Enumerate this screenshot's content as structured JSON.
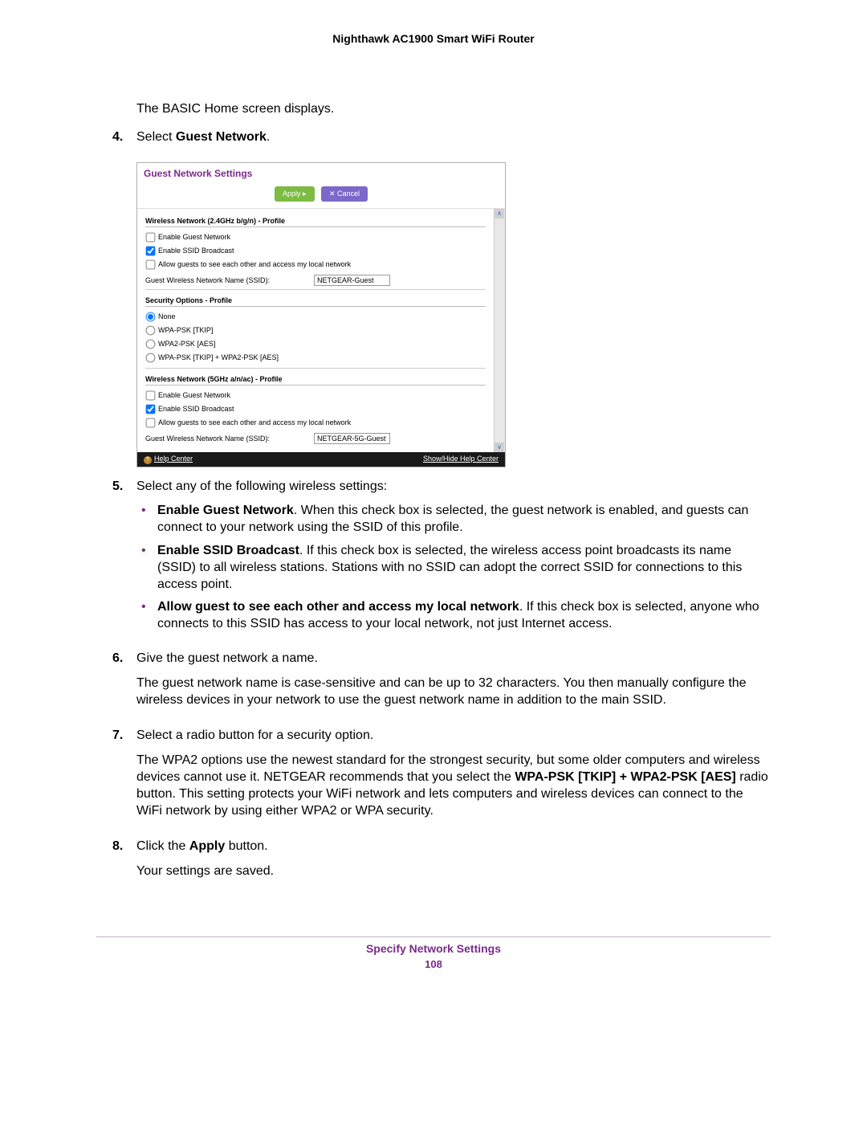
{
  "header": {
    "title": "Nighthawk AC1900 Smart WiFi Router"
  },
  "intro": {
    "line": "The BASIC Home screen displays."
  },
  "step4": {
    "num": "4.",
    "pre": "Select ",
    "bold": "Guest Network",
    "post": "."
  },
  "screenshot": {
    "title": "Guest Network Settings",
    "apply": "Apply ▸",
    "cancel": "✕ Cancel",
    "sec24": {
      "header": "Wireless Network (2.4GHz b/g/n) - Profile",
      "enable_guest": "Enable Guest Network",
      "enable_ssid": "Enable SSID Broadcast",
      "allow_guests": "Allow guests to see each other and access my local network",
      "ssid_label": "Guest Wireless Network Name (SSID):",
      "ssid_value": "NETGEAR-Guest"
    },
    "security": {
      "header": "Security Options - Profile",
      "none": "None",
      "wpa_tkip": "WPA-PSK [TKIP]",
      "wpa2_aes": "WPA2-PSK [AES]",
      "wpa_mix": "WPA-PSK [TKIP] + WPA2-PSK [AES]"
    },
    "sec5": {
      "header": "Wireless Network (5GHz a/n/ac) - Profile",
      "enable_guest": "Enable Guest Network",
      "enable_ssid": "Enable SSID Broadcast",
      "allow_guests": "Allow guests to see each other and access my local network",
      "ssid_label": "Guest Wireless Network Name (SSID):",
      "ssid_value": "NETGEAR-5G-Guest"
    },
    "help_center": "Help Center",
    "show_hide": "Show/Hide Help Center"
  },
  "step5": {
    "num": "5.",
    "text": "Select any of the following wireless settings:",
    "b1_bold": "Enable Guest Network",
    "b1_rest": ". When this check box is selected, the guest network is enabled, and guests can connect to your network using the SSID of this profile.",
    "b2_bold": "Enable SSID Broadcast",
    "b2_rest": ". If this check box is selected, the wireless access point broadcasts its name (SSID) to all wireless stations. Stations with no SSID can adopt the correct SSID for connections to this access point.",
    "b3_bold": "Allow guest to see each other and access my local network",
    "b3_rest": ". If this check box is selected, anyone who connects to this SSID has access to your local network, not just Internet access."
  },
  "step6": {
    "num": "6.",
    "text1": "Give the guest network a name.",
    "text2": "The guest network name is case-sensitive and can be up to 32 characters. You then manually configure the wireless devices in your network to use the guest network name in addition to the main SSID."
  },
  "step7": {
    "num": "7.",
    "text1": "Select a radio button for a security option.",
    "p2_a": "The WPA2 options use the newest standard for the strongest security, but some older computers and wireless devices cannot use it. NETGEAR recommends that you select the ",
    "p2_bold": "WPA-PSK [TKIP] + WPA2-PSK [AES]",
    "p2_b": " radio button. This setting protects your WiFi network and lets computers and wireless devices can connect to the WiFi network by using either WPA2 or WPA security."
  },
  "step8": {
    "num": "8.",
    "pre": "Click the ",
    "bold": "Apply",
    "post": " button.",
    "text2": "Your settings are saved."
  },
  "footer": {
    "section": "Specify Network Settings",
    "page": "108"
  }
}
